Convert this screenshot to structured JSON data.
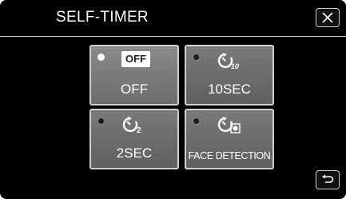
{
  "header": {
    "title": "SELF-TIMER",
    "close_icon": "close-icon"
  },
  "options": [
    {
      "label": "OFF",
      "badge": "OFF",
      "icon": "off-badge",
      "selected": true
    },
    {
      "label": "10SEC",
      "icon": "self-timer-10-icon",
      "selected": false
    },
    {
      "label": "2SEC",
      "icon": "self-timer-2-icon",
      "selected": false
    },
    {
      "label": "FACE DETECTION",
      "icon": "face-detection-timer-icon",
      "selected": false
    }
  ],
  "footer": {
    "back_icon": "return-icon"
  },
  "colors": {
    "background": "#000000",
    "tile": "#6e6e6e",
    "tile_border": "#cfcfcf",
    "selected_dot": "#ffffff"
  }
}
